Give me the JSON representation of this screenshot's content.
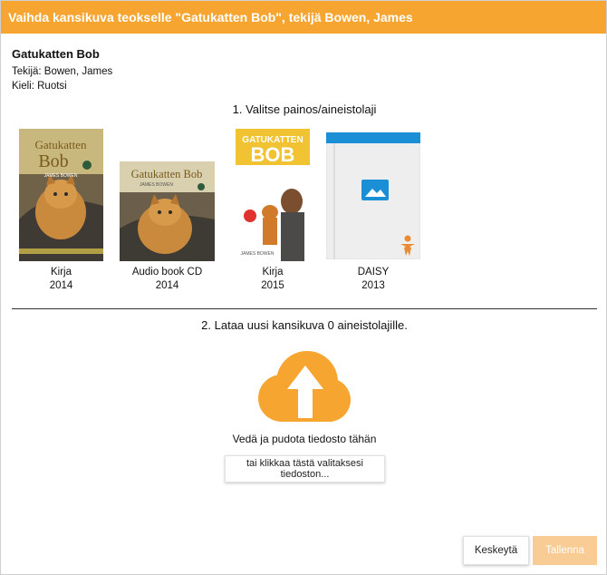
{
  "dialog": {
    "title": "Vaihda kansikuva teokselle \"Gatukatten Bob\", tekijä Bowen, James"
  },
  "work": {
    "title": "Gatukatten Bob",
    "author_line": "Tekijä: Bowen, James",
    "language_line": "Kieli: Ruotsi"
  },
  "step1": {
    "label": "1. Valitse painos/aineistolaji"
  },
  "editions": [
    {
      "format": "Kirja",
      "year": "2014",
      "cover_title": "Gatukatten",
      "cover_title2": "Bob",
      "cover_author": "JAMES BOWEN"
    },
    {
      "format": "Audio book CD",
      "year": "2014",
      "cover_title": "Gatukatten Bob",
      "cover_author": "JAMES BOWEN"
    },
    {
      "format": "Kirja",
      "year": "2015",
      "cover_title": "GATUKATTEN",
      "cover_title2": "BOB",
      "cover_author": "JAMES BOWEN"
    },
    {
      "format": "DAISY",
      "year": "2013"
    }
  ],
  "step2": {
    "label": "2. Lataa uusi kansikuva 0 aineistolajille.",
    "drop_text": "Vedä ja pudota tiedosto tähän",
    "browse_label": "tai klikkaa tästä valitaksesi tiedoston..."
  },
  "footer": {
    "cancel_label": "Keskeytä",
    "save_label": "Tallenna"
  },
  "colors": {
    "accent": "#f7a531",
    "save_disabled": "#f9cc95",
    "placeholder_blue": "#1b8fd6"
  },
  "icons": {
    "upload": "cloud-upload-icon",
    "placeholder": "image-placeholder-icon",
    "daisy": "daisy-person-icon"
  }
}
